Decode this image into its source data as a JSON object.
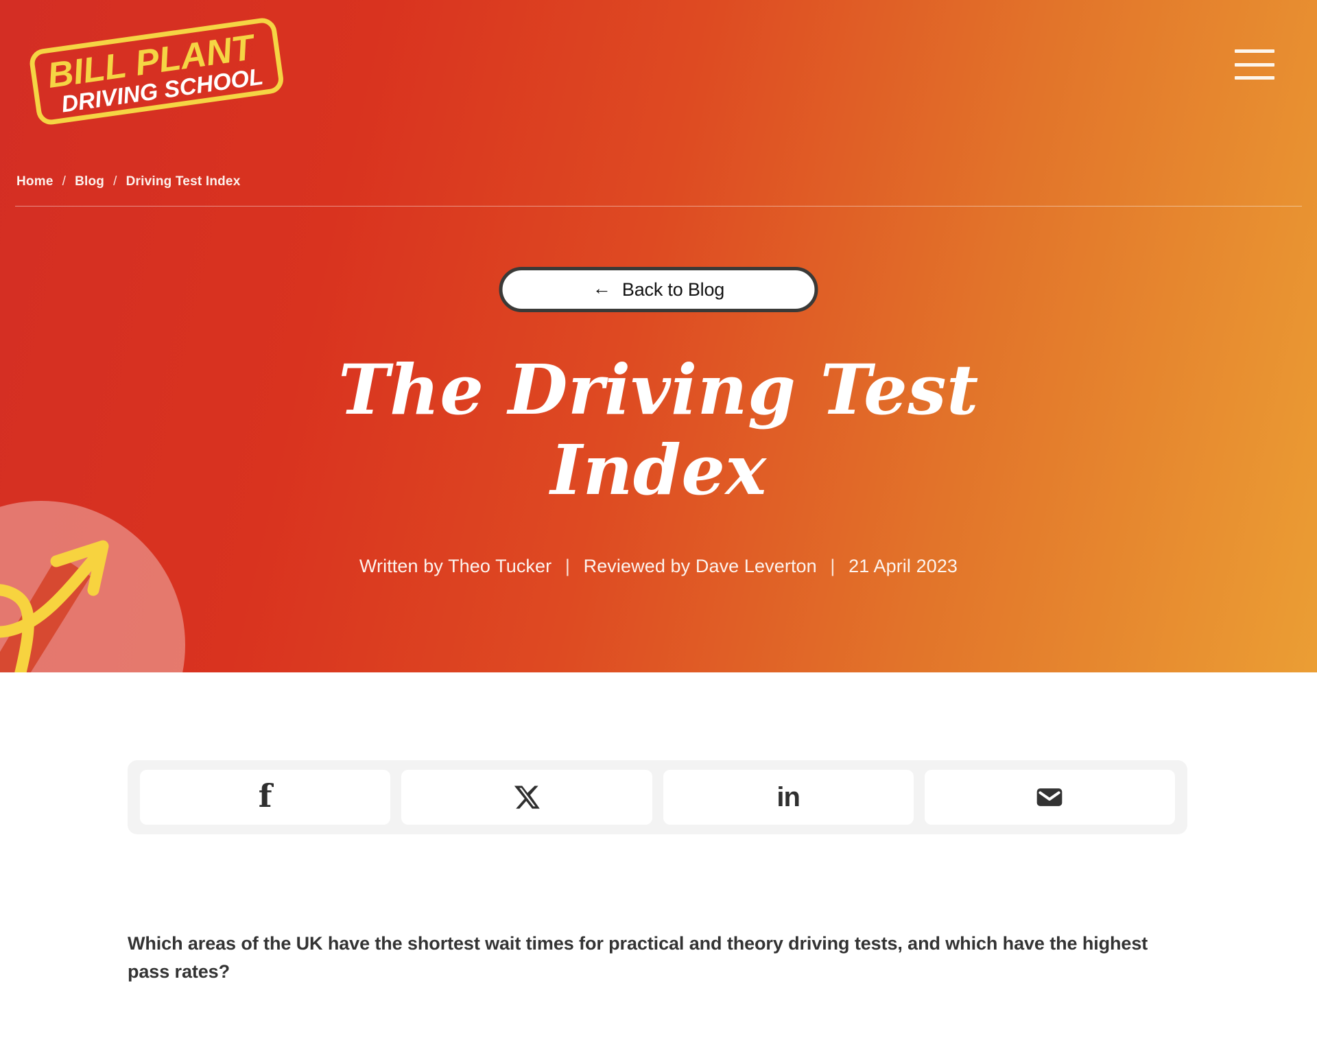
{
  "brand": {
    "logo_line1": "BILL PLANT",
    "logo_line2": "DRIVING SCHOOL",
    "logo_border_color": "#f5d544",
    "logo_line1_color": "#f5d544",
    "logo_line2_color": "#ffffff"
  },
  "colors": {
    "hero_gradient_start": "#d42e24",
    "hero_gradient_end": "#eb9e34",
    "accent_yellow": "#f5d544",
    "button_border": "#3a3a38",
    "text_dark": "#333333",
    "share_bar_bg": "#f3f3f3"
  },
  "header": {
    "menu_icon": "hamburger-menu-icon"
  },
  "breadcrumb": {
    "items": [
      {
        "label": "Home",
        "current": false
      },
      {
        "label": "Blog",
        "current": false
      },
      {
        "label": "Driving Test Index",
        "current": true
      }
    ],
    "separator": "/"
  },
  "hero": {
    "back_button": {
      "label": "Back to Blog",
      "icon": "arrow-left-icon",
      "arrow_glyph": "←"
    },
    "title": "The Driving Test Index",
    "title_line1": "The Driving Test",
    "title_line2": "Index",
    "byline": {
      "written_by": "Written by Theo Tucker",
      "reviewed_by": "Reviewed by Dave Leverton",
      "date": "21 April 2023",
      "separator": "|"
    },
    "decoration": {
      "circle": "pink-circle-shape",
      "tick": "red-tick-shape",
      "arrow": "yellow-looping-arrow"
    }
  },
  "share": {
    "buttons": [
      {
        "name": "facebook",
        "icon": "facebook-icon",
        "glyph": "f"
      },
      {
        "name": "x-twitter",
        "icon": "x-twitter-icon",
        "glyph": "X"
      },
      {
        "name": "linkedin",
        "icon": "linkedin-icon",
        "glyph": "in"
      },
      {
        "name": "email",
        "icon": "email-icon",
        "glyph": "✉"
      }
    ]
  },
  "article": {
    "intro": "Which areas of the UK have the shortest wait times for practical and theory driving tests, and which have the highest pass rates?"
  }
}
